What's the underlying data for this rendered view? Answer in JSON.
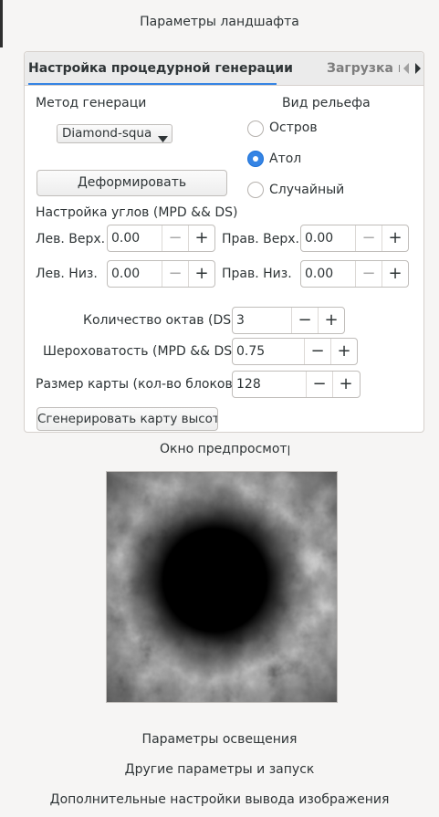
{
  "window": {
    "header_title": "Параметры ландшафта"
  },
  "tabs": {
    "active_label": "Настройка процедурной генерации",
    "other_label": "Загрузка ка"
  },
  "generation": {
    "method_label": "Метод генераци",
    "method_value": "Diamond-squa",
    "deform_button": "Деформировать",
    "relief_label": "Вид рельефа",
    "relief_options": [
      "Остров",
      "Атол",
      "Случайный"
    ],
    "relief_selected": "Атол",
    "corners_label": "Настройка углов (MPD && DS)",
    "corners": {
      "top_left_label": "Лев. Верх.",
      "top_left_value": "0.00",
      "top_right_label": "Прав. Верх.",
      "top_right_value": "0.00",
      "bottom_left_label": "Лев. Низ.",
      "bottom_left_value": "0.00",
      "bottom_right_label": "Прав. Низ.",
      "bottom_right_value": "0.00"
    },
    "octaves_label": "Количество октав (DS)",
    "octaves_value": "3",
    "roughness_label": "Шероховатость (MPD && DS)",
    "roughness_value": "0.75",
    "map_size_label": "Размер карты (кол-во блоков)",
    "map_size_value": "128",
    "generate_button": "Сгенерировать карту высот"
  },
  "preview": {
    "title": "Окно предпросмотр"
  },
  "sections": {
    "lighting": "Параметры освещения",
    "other_launch": "Другие параметры и запуск",
    "output_settings": "Дополнительные настройки вывода изображения"
  },
  "symbols": {
    "minus": "−",
    "plus": "+"
  },
  "colors": {
    "accent": "#3584e4",
    "background": "#f6f5f4",
    "panel": "#ffffff"
  },
  "icons": {
    "tab_scroll_left": "triangle-left-icon",
    "tab_scroll_right": "triangle-right-icon",
    "combo_arrow": "triangle-down-icon"
  }
}
